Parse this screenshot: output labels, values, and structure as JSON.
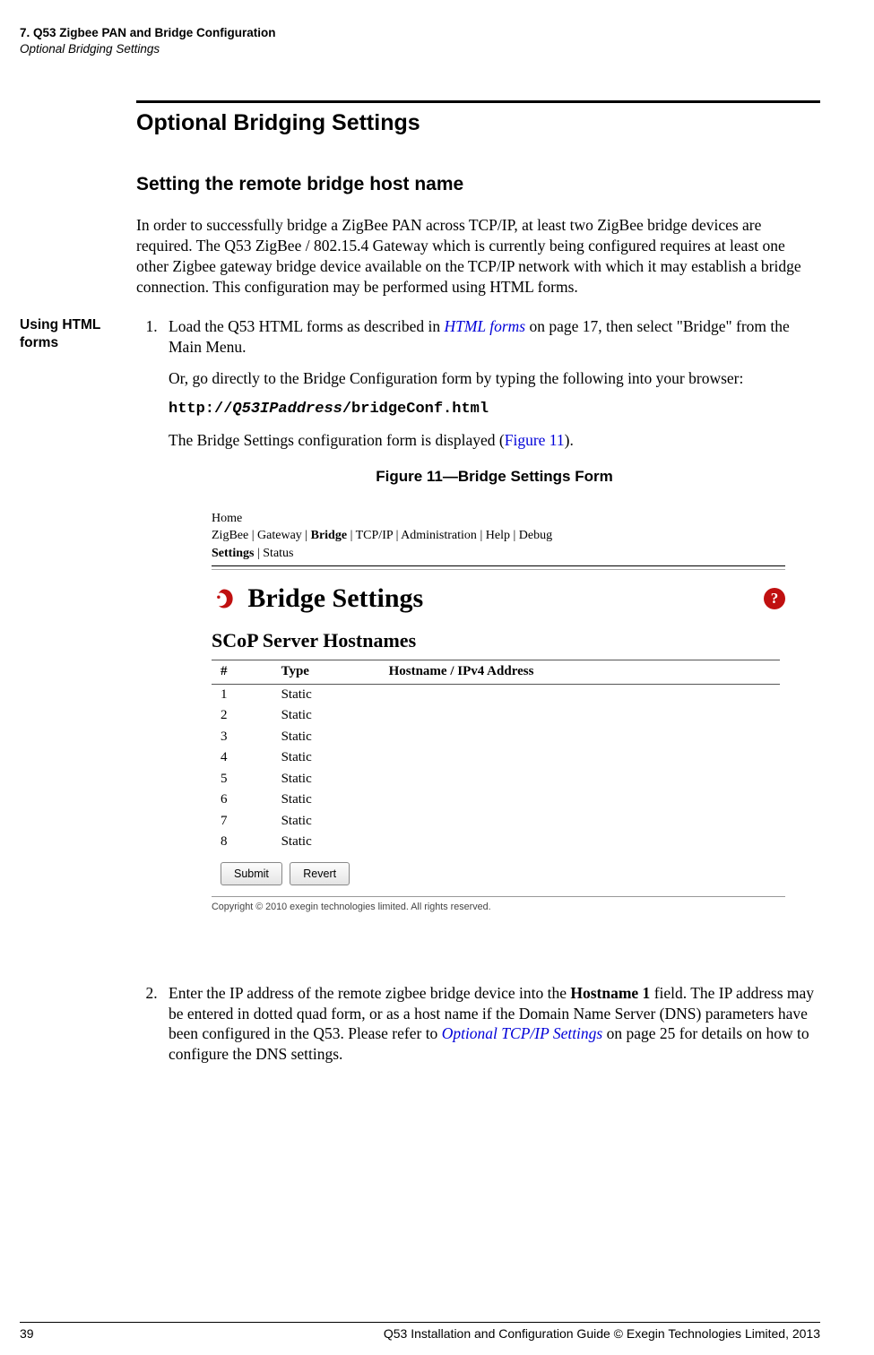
{
  "header": {
    "chapter": "7. Q53 Zigbee PAN and Bridge Configuration",
    "section": "Optional Bridging Settings"
  },
  "titles": {
    "h1": "Optional Bridging Settings",
    "h2": "Setting the remote bridge host name"
  },
  "intro": "In order to successfully bridge a ZigBee PAN across TCP/IP, at least two ZigBee bridge devices are required. The Q53 ZigBee / 802.15.4 Gateway which is currently being configured requires at least one other Zigbee gateway bridge device available on the TCP/IP network with which it may establish a bridge connection. This configuration may be performed using HTML forms.",
  "margin_note": "Using HTML forms",
  "steps": {
    "s1a_pre": "Load the Q53 HTML forms as described in ",
    "s1a_link": "HTML forms",
    "s1a_post": " on page 17, then select \"Bridge\" from the Main Menu.",
    "s1b": "Or, go directly to the Bridge Configuration form by typing the following into your browser:",
    "s1_code_pre": "http://",
    "s1_code_it": "Q53IPaddress",
    "s1_code_post": "/bridgeConf.html",
    "s1c_pre": "The Bridge Settings configuration form is displayed (",
    "s1c_link": "Figure 11",
    "s1c_post": ").",
    "s2_pre": "Enter the IP address of the remote zigbee bridge device into the ",
    "s2_bold": "Hostname 1",
    "s2_mid": " field. The IP address may be entered in dotted quad form, or as a host name if the Domain Name Server (DNS) parameters have been configured in the Q53. Please refer to ",
    "s2_link": "Optional TCP/IP Settings",
    "s2_post": " on page 25 for details on how to configure the DNS settings."
  },
  "figure": {
    "caption": "Figure 11—Bridge Settings Form",
    "nav": {
      "home": "Home",
      "zigbee": "ZigBee",
      "gateway": "Gateway",
      "bridge": "Bridge",
      "tcpip": "TCP/IP",
      "admin": "Administration",
      "help": "Help",
      "debug": "Debug",
      "settings": "Settings",
      "status": "Status"
    },
    "title": "Bridge Settings",
    "subsection": "SCoP Server Hostnames",
    "table": {
      "headers": {
        "num": "#",
        "type": "Type",
        "host": "Hostname / IPv4 Address"
      },
      "rows": [
        {
          "num": "1",
          "type": "Static",
          "host": ""
        },
        {
          "num": "2",
          "type": "Static",
          "host": ""
        },
        {
          "num": "3",
          "type": "Static",
          "host": ""
        },
        {
          "num": "4",
          "type": "Static",
          "host": ""
        },
        {
          "num": "5",
          "type": "Static",
          "host": ""
        },
        {
          "num": "6",
          "type": "Static",
          "host": ""
        },
        {
          "num": "7",
          "type": "Static",
          "host": ""
        },
        {
          "num": "8",
          "type": "Static",
          "host": ""
        }
      ]
    },
    "buttons": {
      "submit": "Submit",
      "revert": "Revert"
    },
    "copyright": "Copyright © 2010 exegin technologies limited. All rights reserved."
  },
  "footer": {
    "page": "39",
    "text": "Q53 Installation and Configuration Guide  © Exegin Technologies Limited, 2013"
  }
}
